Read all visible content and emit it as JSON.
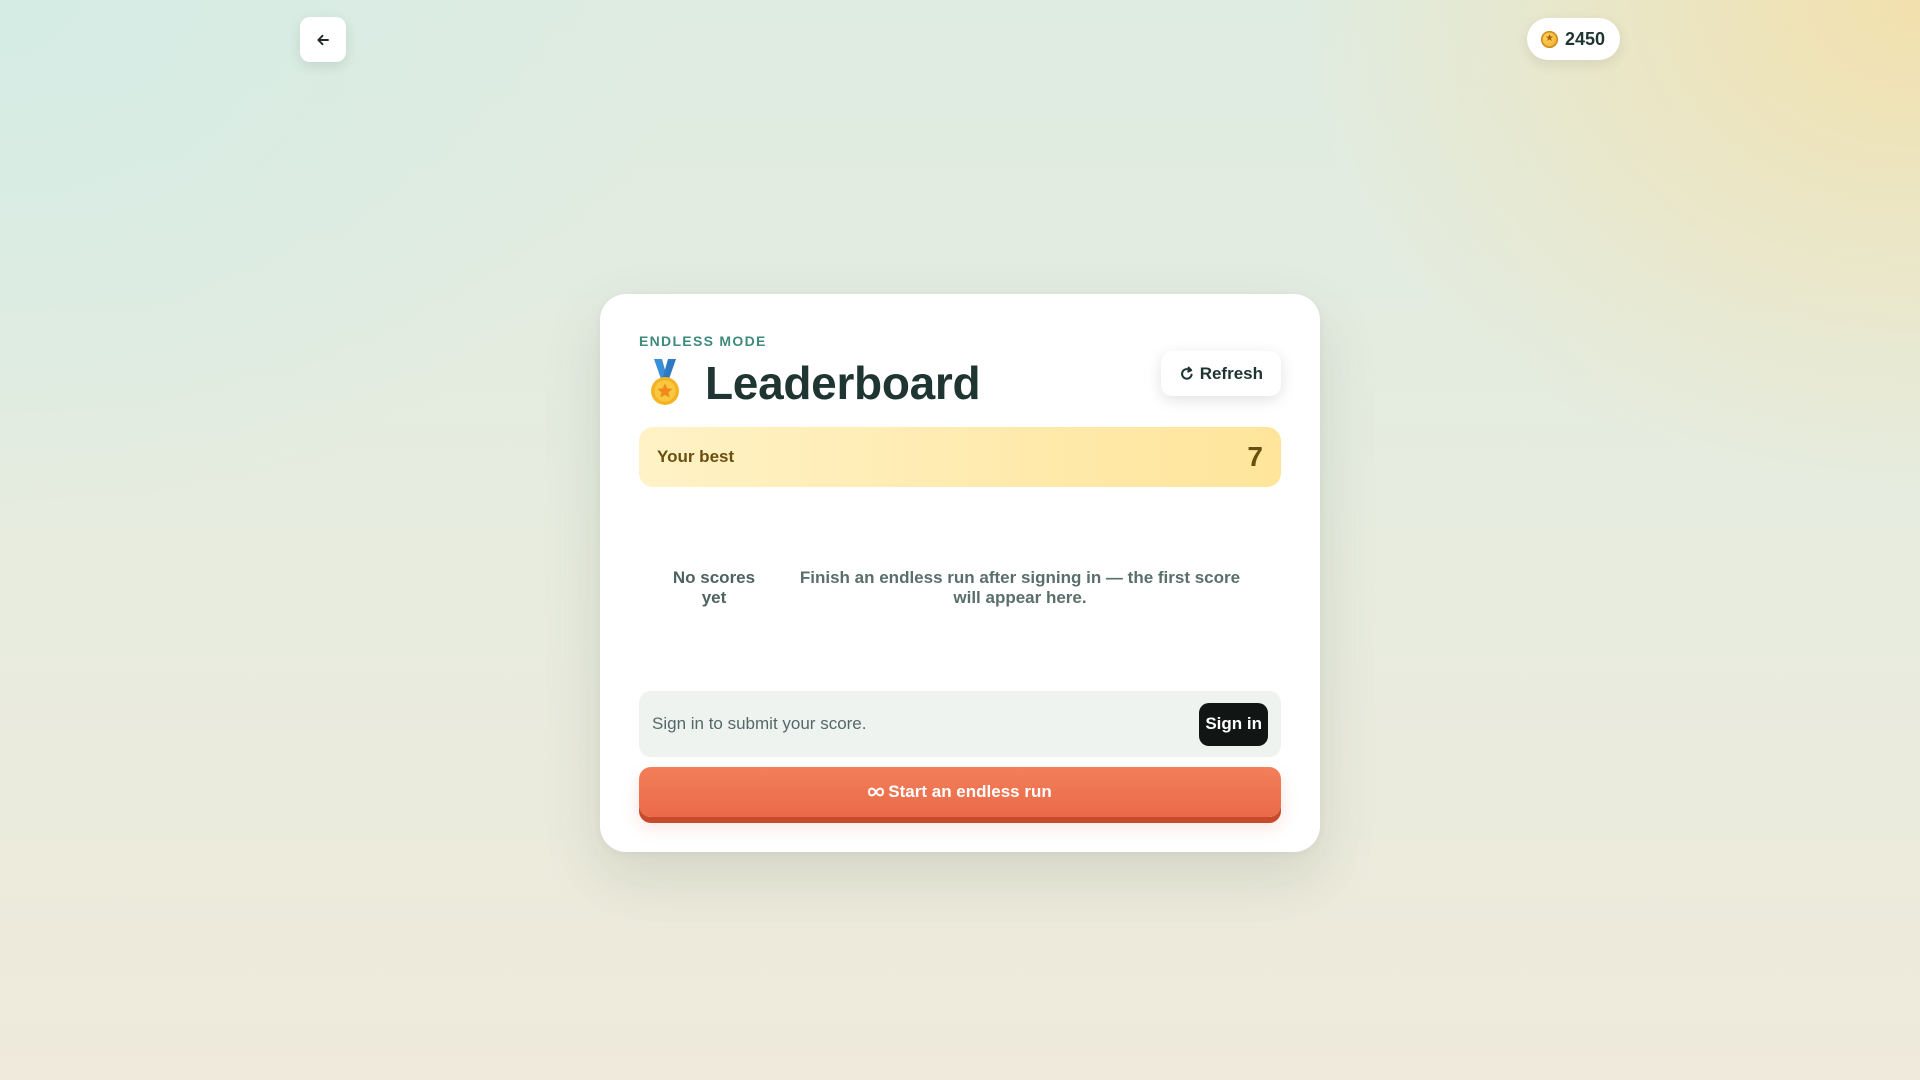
{
  "header": {
    "back_icon": "arrow-left-icon",
    "coins": {
      "icon": "coin-star-icon",
      "value": "2450"
    }
  },
  "card": {
    "eyebrow": "ENDLESS MODE",
    "medal_icon": "medal-icon",
    "title": "Leaderboard",
    "refresh": {
      "icon": "refresh-icon",
      "label": "Refresh"
    },
    "best": {
      "label": "Your best",
      "value": "7"
    },
    "empty_state": {
      "title": "No scores yet",
      "description": "Finish an endless run after signing in — the first score will appear here."
    },
    "signin": {
      "text": "Sign in to submit your score.",
      "button": "Sign in"
    },
    "start_button": {
      "icon": "infinity-icon",
      "label": "Start an endless run"
    }
  },
  "colors": {
    "accent": "#ea6a48",
    "eyebrow": "#3e8a7c",
    "best_bg": "#ffe59b",
    "title": "#1f3532"
  }
}
